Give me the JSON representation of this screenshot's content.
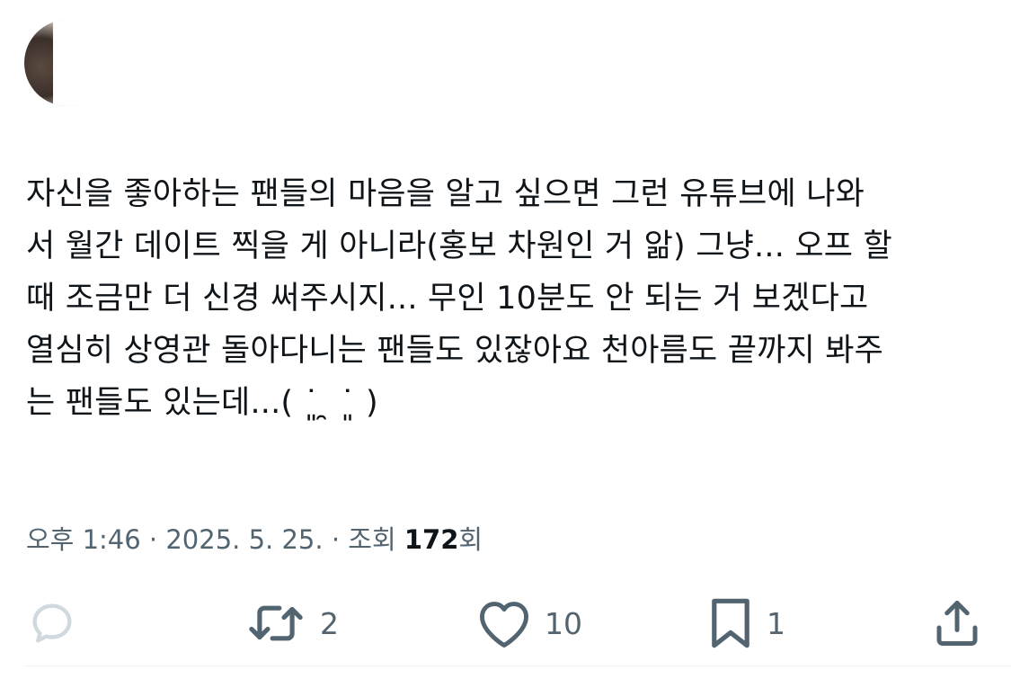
{
  "tweet": {
    "lines": [
      "자신을 좋아하는 팬들의 마음을 알고 싶으면 그런 유튜브에 나와",
      "서 월간 데이트 찍을 게 아니라(홍보 차원인 거 앎) 그냥... 오프 할",
      "때 조금만 더 신경 써주시지... 무인 10분도 안 되는 거 보겠다고",
      "열심히 상영관 돌아다니는 팬들도 있잖아요 천아름도 끝까지 봐주",
      "는 팬들도 있는데...( ˙͈ ̯ ˙͈ )"
    ]
  },
  "meta": {
    "time": "오후 1:46",
    "separator": " · ",
    "date": "2025. 5. 25.",
    "views_label": "조회 ",
    "views_count": "172",
    "views_suffix": "회"
  },
  "actions": {
    "reply": {
      "icon": "reply-icon",
      "count": ""
    },
    "retweet": {
      "icon": "retweet-icon",
      "count": "2"
    },
    "like": {
      "icon": "heart-icon",
      "count": "10"
    },
    "bookmark": {
      "icon": "bookmark-icon",
      "count": "1"
    },
    "share": {
      "icon": "share-icon",
      "count": ""
    }
  },
  "colors": {
    "text": "#0f1419",
    "secondary": "#536471",
    "reply_icon": "#cfd9de",
    "divider": "#eff3f4"
  }
}
